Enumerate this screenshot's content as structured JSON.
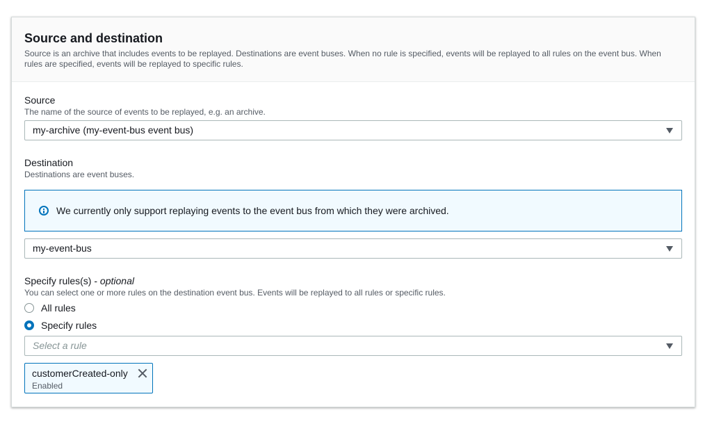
{
  "panel": {
    "title": "Source and destination",
    "description": "Source is an archive that includes events to be replayed. Destinations are event buses. When no rule is specified, events will be replayed to all rules on the event bus. When rules are specified, events will be replayed to specific rules."
  },
  "source": {
    "label": "Source",
    "description": "The name of the source of events to be replayed, e.g. an archive.",
    "selected": "my-archive (my-event-bus event bus)"
  },
  "destination": {
    "label": "Destination",
    "description": "Destinations are event buses.",
    "alert": "We currently only support replaying events to the event bus from which they were archived.",
    "selected": "my-event-bus"
  },
  "rules": {
    "label": "Specify rules(s)",
    "optional": "optional",
    "separator": " - ",
    "description": "You can select one or more rules on the destination event bus. Events will be replayed to all rules or specific rules.",
    "options": [
      "All rules",
      "Specify rules"
    ],
    "selected_option": "Specify rules",
    "placeholder": "Select a rule",
    "token": {
      "name": "customerCreated-only",
      "status": "Enabled"
    }
  },
  "colors": {
    "accent": "#0073bb",
    "alert_bg": "#f1faff",
    "border": "#aab7b8"
  },
  "icons": {
    "info": "info-icon",
    "caret": "caret-down-icon",
    "dismiss": "close-icon"
  }
}
